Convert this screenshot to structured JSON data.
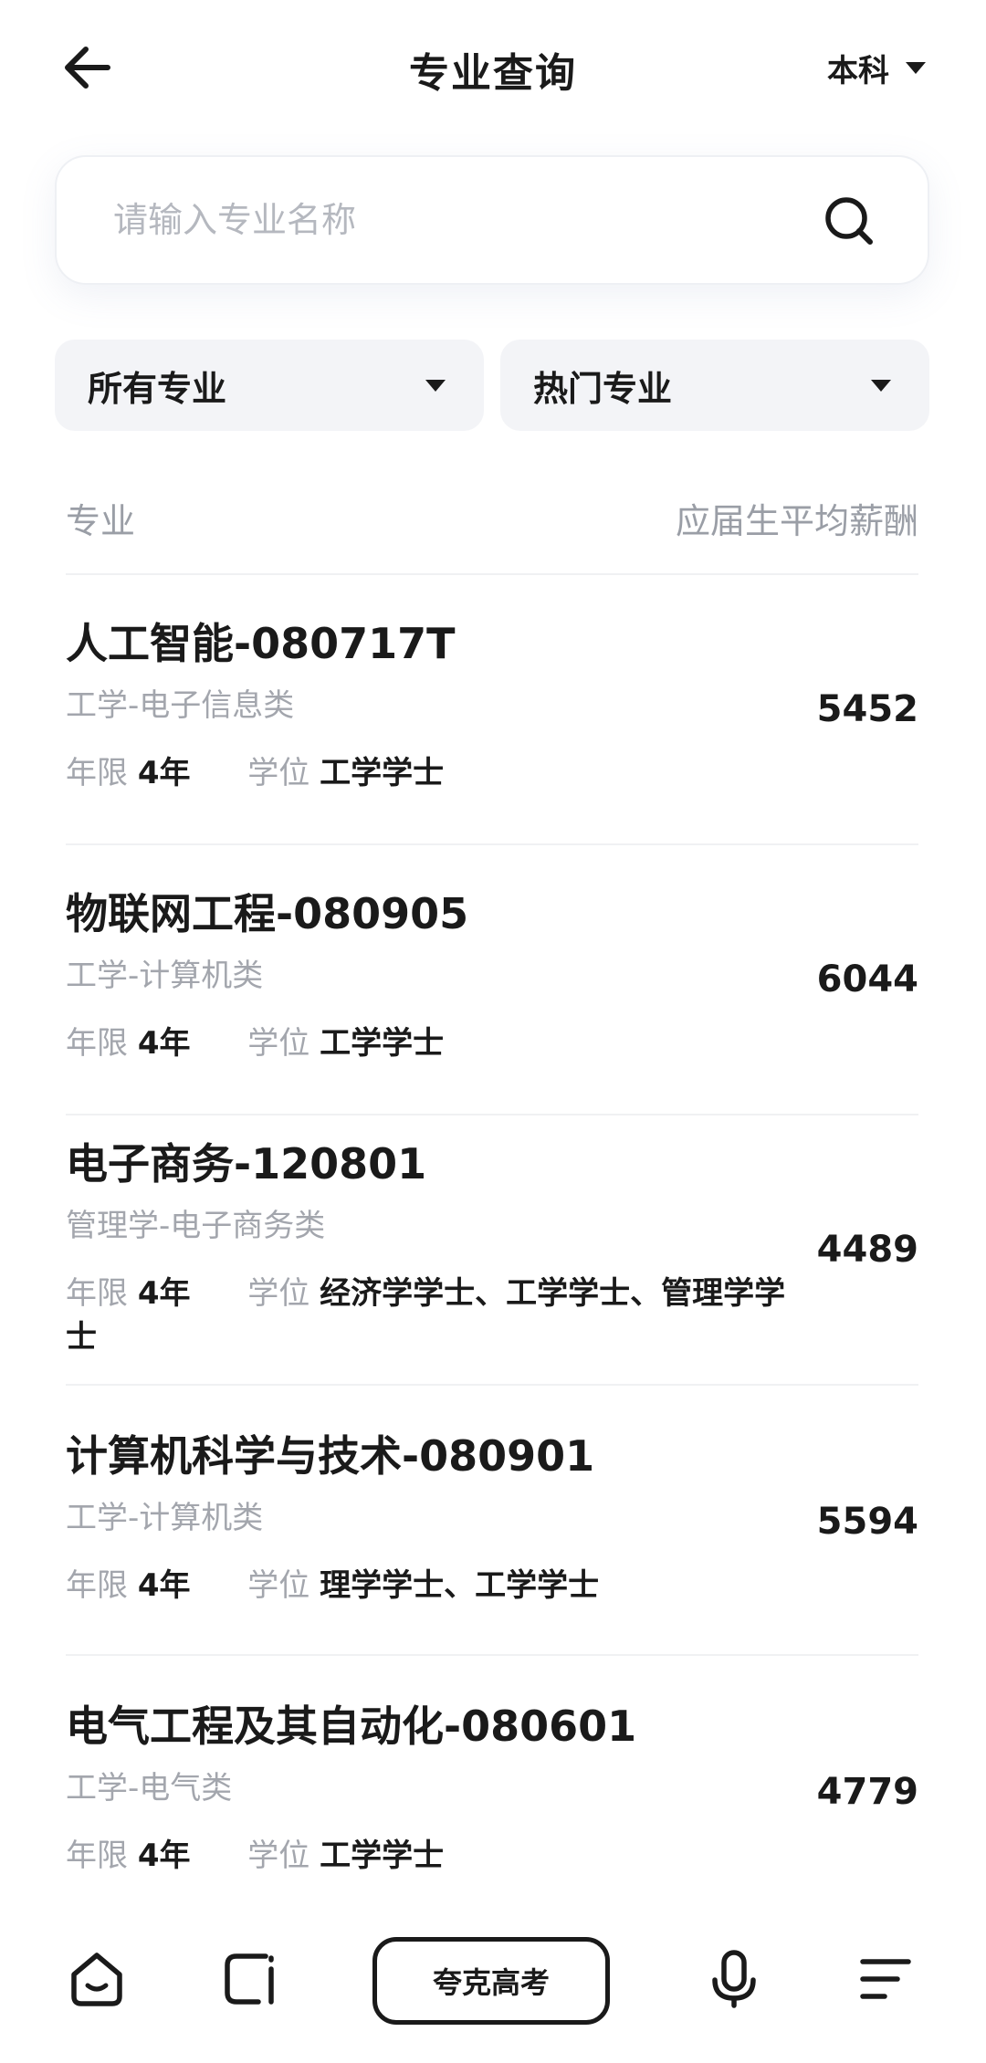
{
  "header": {
    "title": "专业查询",
    "level": "本科"
  },
  "search": {
    "placeholder": "请输入专业名称"
  },
  "filters": {
    "category": "所有专业",
    "sort": "热门专业"
  },
  "columns": {
    "major": "专业",
    "salary": "应届生平均薪酬"
  },
  "labels": {
    "years": "年限",
    "degree": "学位"
  },
  "majors": [
    {
      "name": "人工智能-080717T",
      "category": "工学-电子信息类",
      "years": "4年",
      "degree": "工学学士",
      "salary": "5452"
    },
    {
      "name": "物联网工程-080905",
      "category": "工学-计算机类",
      "years": "4年",
      "degree": "工学学士",
      "salary": "6044"
    },
    {
      "name": "电子商务-120801",
      "category": "管理学-电子商务类",
      "years": "4年",
      "degree": "经济学学士、工学学士、管理学学士",
      "salary": "4489"
    },
    {
      "name": "计算机科学与技术-080901",
      "category": "工学-计算机类",
      "years": "4年",
      "degree": "理学学士、工学学士",
      "salary": "5594"
    },
    {
      "name": "电气工程及其自动化-080601",
      "category": "工学-电气类",
      "years": "4年",
      "degree": "工学学士",
      "salary": "4779"
    }
  ],
  "bottom_nav": {
    "center_label": "夸克高考",
    "icons": [
      "home-icon",
      "tabs-icon",
      "microphone-icon",
      "menu-icon"
    ]
  },
  "colors": {
    "text": "#1a1a1a",
    "muted": "#a3a6ad",
    "filter_bg": "#f3f4f7"
  }
}
